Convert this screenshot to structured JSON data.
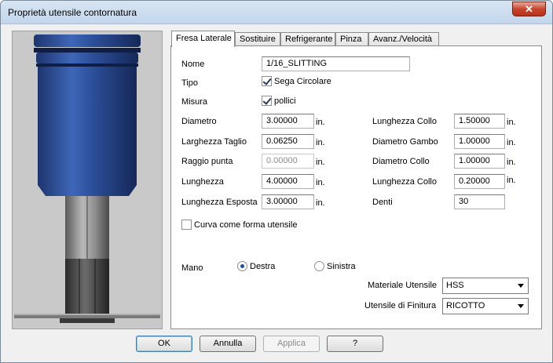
{
  "window": {
    "title": "Proprietà utensile contornatura"
  },
  "tabs": [
    "Fresa Laterale",
    "Sostituire",
    "Refrigerante",
    "Pinza",
    "Avanz./Velocità"
  ],
  "form": {
    "nome_label": "Nome",
    "nome_value": "1/16_SLITTING",
    "tipo_label": "Tipo",
    "tipo_check_label": "Sega Circolare",
    "tipo_checked": true,
    "misura_label": "Misura",
    "misura_check_label": "pollici",
    "misura_checked": true,
    "left_fields": [
      {
        "label": "Diametro",
        "value": "3.00000",
        "unit": "in.",
        "disabled": false
      },
      {
        "label": "Larghezza Taglio",
        "value": "0.06250",
        "unit": "in.",
        "disabled": false
      },
      {
        "label": "Raggio punta",
        "value": "0.00000",
        "unit": "in.",
        "disabled": true
      },
      {
        "label": "Lunghezza",
        "value": "4.00000",
        "unit": "in.",
        "disabled": false
      },
      {
        "label": "Lunghezza Esposta",
        "value": "3.00000",
        "unit": "in.",
        "disabled": false
      }
    ],
    "right_fields": [
      {
        "label": "Lunghezza Collo",
        "value": "1.50000",
        "unit": "in."
      },
      {
        "label": "Diametro Gambo",
        "value": "1.00000",
        "unit": "in."
      },
      {
        "label": "Diametro Collo",
        "value": "1.00000",
        "unit": "in."
      },
      {
        "label": "Lunghezza Collo",
        "value": "0.20000",
        "unit": "in."
      },
      {
        "label": "Denti",
        "value": "30",
        "unit": ""
      }
    ],
    "curva_label": "Curva come forma utensile",
    "curva_checked": false,
    "mano_label": "Mano",
    "mano_options": [
      "Destra",
      "Sinistra"
    ],
    "mano_selected": "Destra",
    "materiale_label": "Materiale Utensile",
    "materiale_value": "HSS",
    "finitura_label": "Utensile di Finitura",
    "finitura_value": "RICOTTO"
  },
  "buttons": {
    "ok": "OK",
    "annulla": "Annulla",
    "applica": "Applica",
    "help": "?"
  },
  "colors": {
    "tool_body": "#2c4f9a",
    "tool_shank": "#8a8a8a",
    "preview_bg": "#c9c9c9"
  },
  "icons": {
    "close": "close-icon"
  }
}
